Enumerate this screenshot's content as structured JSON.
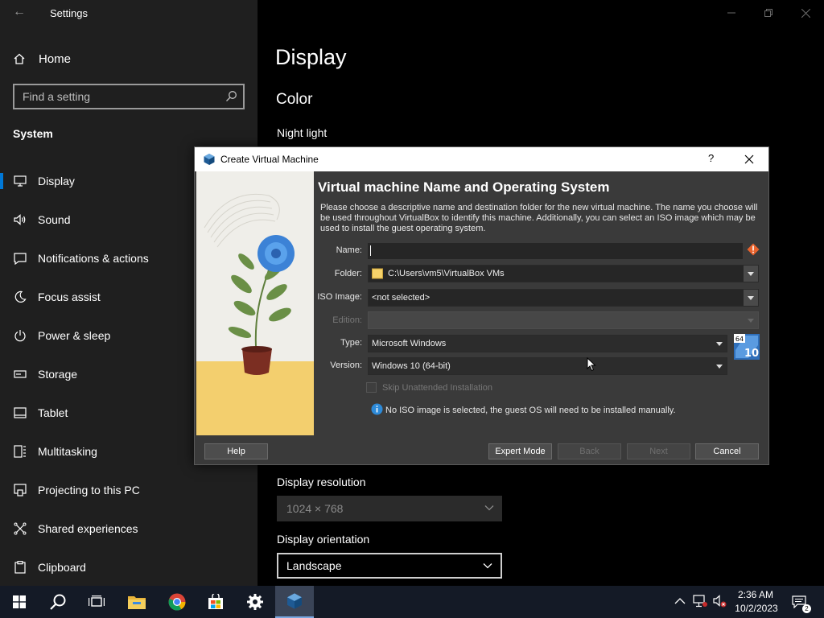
{
  "settings": {
    "app_title": "Settings",
    "home_label": "Home",
    "search_placeholder": "Find a setting",
    "section_heading": "System",
    "nav_items": [
      {
        "label": "Display",
        "icon": "monitor-icon",
        "selected": true
      },
      {
        "label": "Sound",
        "icon": "speaker-icon"
      },
      {
        "label": "Notifications & actions",
        "icon": "notification-icon"
      },
      {
        "label": "Focus assist",
        "icon": "moon-icon"
      },
      {
        "label": "Power & sleep",
        "icon": "power-icon"
      },
      {
        "label": "Storage",
        "icon": "storage-icon"
      },
      {
        "label": "Tablet",
        "icon": "tablet-icon"
      },
      {
        "label": "Multitasking",
        "icon": "multitasking-icon"
      },
      {
        "label": "Projecting to this PC",
        "icon": "projecting-icon"
      },
      {
        "label": "Shared experiences",
        "icon": "shared-icon"
      },
      {
        "label": "Clipboard",
        "icon": "clipboard-icon"
      }
    ],
    "page_title": "Display",
    "color_heading": "Color",
    "night_light_label": "Night light",
    "resolution_label": "Display resolution",
    "resolution_value": "1024 × 768",
    "orientation_label": "Display orientation",
    "orientation_value": "Landscape"
  },
  "dialog": {
    "title": "Create Virtual Machine",
    "help_glyph": "?",
    "heading": "Virtual machine Name and Operating System",
    "description": "Please choose a descriptive name and destination folder for the new virtual machine. The name you choose will be used throughout VirtualBox to identify this machine. Additionally, you can select an ISO image which may be used to install the guest operating system.",
    "fields": {
      "name_label": "Name:",
      "name_value": "",
      "folder_label": "Folder:",
      "folder_value": "C:\\Users\\vm5\\VirtualBox VMs",
      "iso_label": "ISO Image:",
      "iso_value": "<not selected>",
      "edition_label": "Edition:",
      "edition_value": "",
      "type_label": "Type:",
      "type_value": "Microsoft Windows",
      "version_label": "Version:",
      "version_value": "Windows 10 (64-bit)"
    },
    "os_badge": {
      "bits": "64",
      "version": "10"
    },
    "skip_unattended_label": "Skip Unattended Installation",
    "skip_unattended_checked": false,
    "info_message": "No ISO image is selected, the guest OS will need to be installed manually.",
    "buttons": {
      "help": "Help",
      "expert": "Expert Mode",
      "back": "Back",
      "next": "Next",
      "cancel": "Cancel"
    }
  },
  "taskbar": {
    "time": "2:36 AM",
    "date": "10/2/2023",
    "notification_count": "2",
    "pinned": [
      "start-button",
      "search-button",
      "task-view-button",
      "file-explorer-button",
      "chrome-button",
      "store-button",
      "settings-button",
      "virtualbox-button"
    ]
  },
  "colors": {
    "accent": "#0078d7",
    "sidebar_bg": "#1f1f1f",
    "dialog_bg": "#3a3a3a",
    "taskbar_bg": "#141a26",
    "warning": "#e8622c"
  }
}
